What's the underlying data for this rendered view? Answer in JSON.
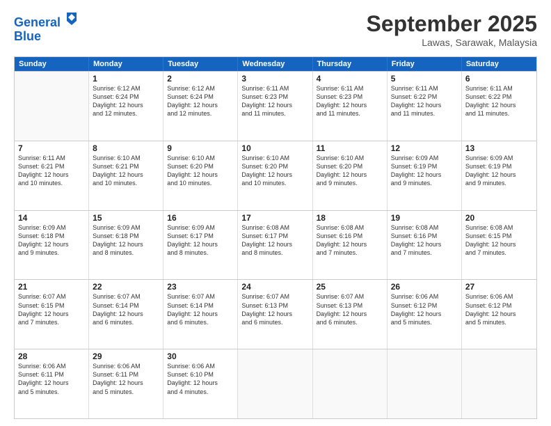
{
  "logo": {
    "line1": "General",
    "line2": "Blue"
  },
  "title": "September 2025",
  "subtitle": "Lawas, Sarawak, Malaysia",
  "headers": [
    "Sunday",
    "Monday",
    "Tuesday",
    "Wednesday",
    "Thursday",
    "Friday",
    "Saturday"
  ],
  "weeks": [
    [
      {
        "day": "",
        "info": ""
      },
      {
        "day": "1",
        "info": "Sunrise: 6:12 AM\nSunset: 6:24 PM\nDaylight: 12 hours\nand 12 minutes."
      },
      {
        "day": "2",
        "info": "Sunrise: 6:12 AM\nSunset: 6:24 PM\nDaylight: 12 hours\nand 12 minutes."
      },
      {
        "day": "3",
        "info": "Sunrise: 6:11 AM\nSunset: 6:23 PM\nDaylight: 12 hours\nand 11 minutes."
      },
      {
        "day": "4",
        "info": "Sunrise: 6:11 AM\nSunset: 6:23 PM\nDaylight: 12 hours\nand 11 minutes."
      },
      {
        "day": "5",
        "info": "Sunrise: 6:11 AM\nSunset: 6:22 PM\nDaylight: 12 hours\nand 11 minutes."
      },
      {
        "day": "6",
        "info": "Sunrise: 6:11 AM\nSunset: 6:22 PM\nDaylight: 12 hours\nand 11 minutes."
      }
    ],
    [
      {
        "day": "7",
        "info": "Sunrise: 6:11 AM\nSunset: 6:21 PM\nDaylight: 12 hours\nand 10 minutes."
      },
      {
        "day": "8",
        "info": "Sunrise: 6:10 AM\nSunset: 6:21 PM\nDaylight: 12 hours\nand 10 minutes."
      },
      {
        "day": "9",
        "info": "Sunrise: 6:10 AM\nSunset: 6:20 PM\nDaylight: 12 hours\nand 10 minutes."
      },
      {
        "day": "10",
        "info": "Sunrise: 6:10 AM\nSunset: 6:20 PM\nDaylight: 12 hours\nand 10 minutes."
      },
      {
        "day": "11",
        "info": "Sunrise: 6:10 AM\nSunset: 6:20 PM\nDaylight: 12 hours\nand 9 minutes."
      },
      {
        "day": "12",
        "info": "Sunrise: 6:09 AM\nSunset: 6:19 PM\nDaylight: 12 hours\nand 9 minutes."
      },
      {
        "day": "13",
        "info": "Sunrise: 6:09 AM\nSunset: 6:19 PM\nDaylight: 12 hours\nand 9 minutes."
      }
    ],
    [
      {
        "day": "14",
        "info": "Sunrise: 6:09 AM\nSunset: 6:18 PM\nDaylight: 12 hours\nand 9 minutes."
      },
      {
        "day": "15",
        "info": "Sunrise: 6:09 AM\nSunset: 6:18 PM\nDaylight: 12 hours\nand 8 minutes."
      },
      {
        "day": "16",
        "info": "Sunrise: 6:09 AM\nSunset: 6:17 PM\nDaylight: 12 hours\nand 8 minutes."
      },
      {
        "day": "17",
        "info": "Sunrise: 6:08 AM\nSunset: 6:17 PM\nDaylight: 12 hours\nand 8 minutes."
      },
      {
        "day": "18",
        "info": "Sunrise: 6:08 AM\nSunset: 6:16 PM\nDaylight: 12 hours\nand 7 minutes."
      },
      {
        "day": "19",
        "info": "Sunrise: 6:08 AM\nSunset: 6:16 PM\nDaylight: 12 hours\nand 7 minutes."
      },
      {
        "day": "20",
        "info": "Sunrise: 6:08 AM\nSunset: 6:15 PM\nDaylight: 12 hours\nand 7 minutes."
      }
    ],
    [
      {
        "day": "21",
        "info": "Sunrise: 6:07 AM\nSunset: 6:15 PM\nDaylight: 12 hours\nand 7 minutes."
      },
      {
        "day": "22",
        "info": "Sunrise: 6:07 AM\nSunset: 6:14 PM\nDaylight: 12 hours\nand 6 minutes."
      },
      {
        "day": "23",
        "info": "Sunrise: 6:07 AM\nSunset: 6:14 PM\nDaylight: 12 hours\nand 6 minutes."
      },
      {
        "day": "24",
        "info": "Sunrise: 6:07 AM\nSunset: 6:13 PM\nDaylight: 12 hours\nand 6 minutes."
      },
      {
        "day": "25",
        "info": "Sunrise: 6:07 AM\nSunset: 6:13 PM\nDaylight: 12 hours\nand 6 minutes."
      },
      {
        "day": "26",
        "info": "Sunrise: 6:06 AM\nSunset: 6:12 PM\nDaylight: 12 hours\nand 5 minutes."
      },
      {
        "day": "27",
        "info": "Sunrise: 6:06 AM\nSunset: 6:12 PM\nDaylight: 12 hours\nand 5 minutes."
      }
    ],
    [
      {
        "day": "28",
        "info": "Sunrise: 6:06 AM\nSunset: 6:11 PM\nDaylight: 12 hours\nand 5 minutes."
      },
      {
        "day": "29",
        "info": "Sunrise: 6:06 AM\nSunset: 6:11 PM\nDaylight: 12 hours\nand 5 minutes."
      },
      {
        "day": "30",
        "info": "Sunrise: 6:06 AM\nSunset: 6:10 PM\nDaylight: 12 hours\nand 4 minutes."
      },
      {
        "day": "",
        "info": ""
      },
      {
        "day": "",
        "info": ""
      },
      {
        "day": "",
        "info": ""
      },
      {
        "day": "",
        "info": ""
      }
    ]
  ]
}
